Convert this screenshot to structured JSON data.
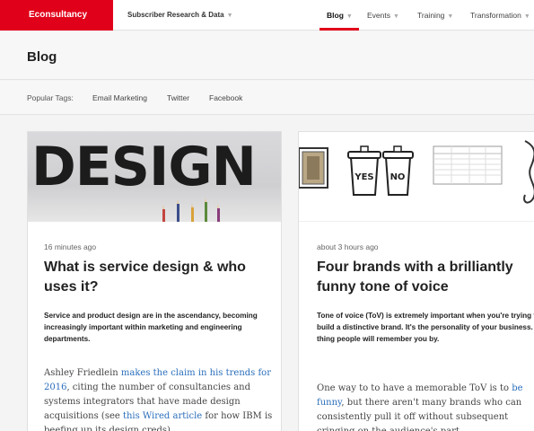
{
  "nav": {
    "logo": "Econsultancy",
    "subscriber": "Subscriber Research & Data",
    "items": [
      {
        "label": "Blog",
        "active": true
      },
      {
        "label": "Events"
      },
      {
        "label": "Training"
      },
      {
        "label": "Transformation"
      }
    ]
  },
  "header": {
    "title": "Blog"
  },
  "tags": {
    "label": "Popular Tags:",
    "items": [
      "Email Marketing",
      "Twitter",
      "Facebook"
    ]
  },
  "articles": [
    {
      "hero_word": "DESIGN",
      "time": "16 minutes ago",
      "title": "What is service design & who uses it?",
      "summary": "Service and product design are in the ascendancy, becoming increasingly important within marketing and engineering departments.",
      "body": {
        "t1": "Ashley Friedlein ",
        "l1": "makes the claim in his trends for 2016",
        "t2": ", citing the number of consultancies and systems integrators that have made design acquisitions (see ",
        "l2": "this Wired article",
        "t3": " for how IBM is beefing up its design creds)."
      }
    },
    {
      "hero_yes": "YES",
      "hero_no": "NO",
      "time": "about 3 hours ago",
      "title": "Four brands with a brilliantly funny tone of voice",
      "summary": "Tone of voice (ToV) is extremely important when you're trying to build a distinctive brand. It's the personality of your business. The thing people will remember you by.",
      "body": {
        "t1": "One way to to have a memorable ToV is to ",
        "l1": "be funny",
        "t2": ", but there aren't many brands who can consistently pull it off without subsequent cringing on the audience's part."
      }
    }
  ]
}
